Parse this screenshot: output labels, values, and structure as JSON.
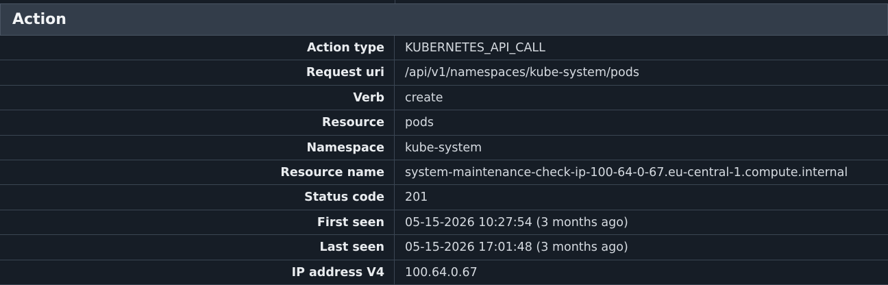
{
  "section": {
    "title": "Action"
  },
  "rows": [
    {
      "key": "Action type",
      "value": "KUBERNETES_API_CALL"
    },
    {
      "key": "Request uri",
      "value": "/api/v1/namespaces/kube-system/pods"
    },
    {
      "key": "Verb",
      "value": "create"
    },
    {
      "key": "Resource",
      "value": "pods"
    },
    {
      "key": "Namespace",
      "value": "kube-system"
    },
    {
      "key": "Resource name",
      "value": "system-maintenance-check-ip-100-64-0-67.eu-central-1.compute.internal"
    },
    {
      "key": "Status code",
      "value": "201"
    },
    {
      "key": "First seen",
      "value": "05-15-2026 10:27:54 (3 months ago)"
    },
    {
      "key": "Last seen",
      "value": "05-15-2026 17:01:48 (3 months ago)"
    },
    {
      "key": "IP address V4",
      "value": "100.64.0.67"
    }
  ]
}
